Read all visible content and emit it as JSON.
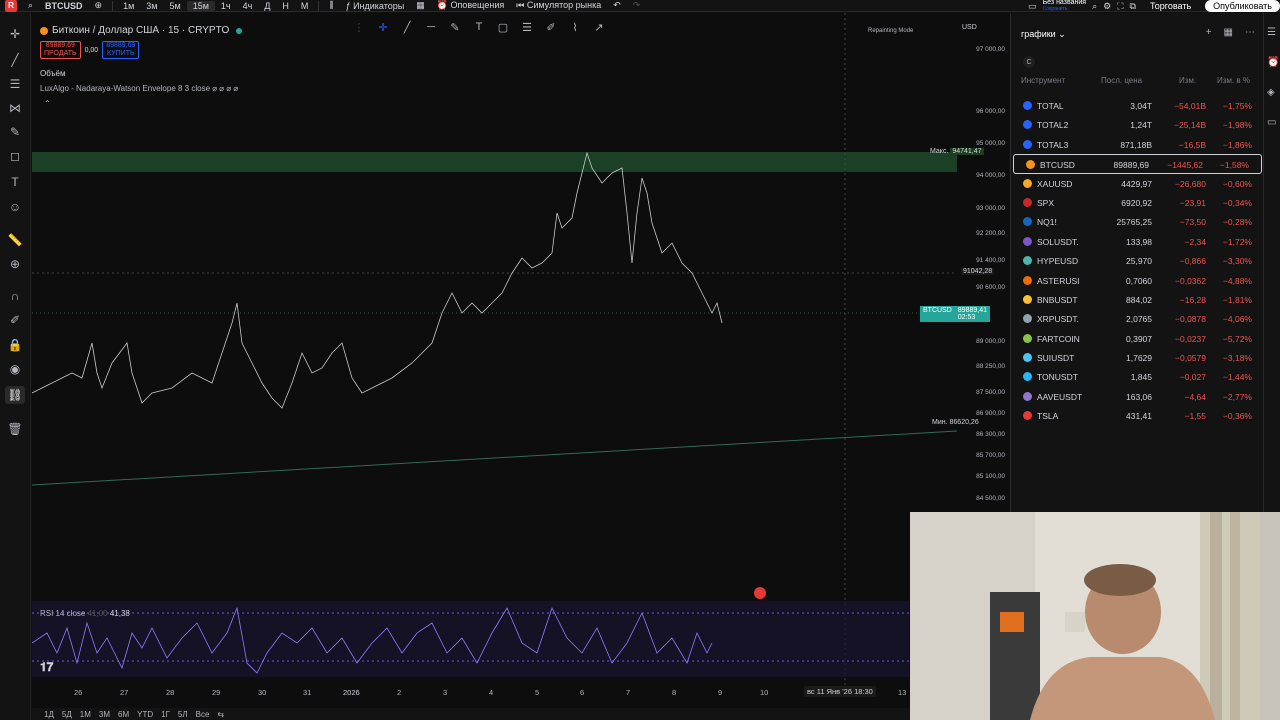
{
  "topbar": {
    "symbol": "BTCUSD",
    "intervals": [
      "1м",
      "3м",
      "5м",
      "15м",
      "1ч",
      "4ч",
      "Д",
      "Н",
      "М"
    ],
    "active_interval": "15м",
    "indicators": "Индикаторы",
    "alerts": "Оповещения",
    "replay": "Симулятор рынка",
    "unnamed_title": "Без названия",
    "unnamed_sub": "Сохранить",
    "trade": "Торговать",
    "publish": "Опубликовать"
  },
  "chart": {
    "title": "Биткоин / Доллар США · 15 · CRYPTO",
    "sell_price": "89889,69",
    "sell_label": "ПРОДАТЬ",
    "spread": "0,00",
    "buy_price": "89889,69",
    "buy_label": "КУПИТЬ",
    "volume_label": "Объём",
    "indicator_label": "LuxAlgo - Nadaraya-Watson Envelope 8 3 close",
    "repainting": "Repainting Mode",
    "currency": "USD",
    "max_label": "Макс.",
    "max_value": "94741,47",
    "min_label": "Мин.",
    "min_value": "86620,26",
    "crosshair_price": "91042,28",
    "current_symbol": "BTCUSD",
    "current_price": "89889,41",
    "current_timer": "02:53",
    "price_ticks": [
      "97 000,00",
      "96 000,00",
      "95 000,00",
      "94 000,00",
      "93 000,00",
      "92 200,00",
      "91 400,00",
      "90 600,00",
      "89 000,00",
      "88 250,00",
      "87 500,00",
      "86 900,00",
      "86 300,00",
      "85 700,00",
      "85 100,00",
      "84 500,00"
    ],
    "rsi_label": "RSI 14 close",
    "rsi_value1": "41,00",
    "rsi_value2": "41,38",
    "time_ticks": [
      "26",
      "27",
      "28",
      "29",
      "30",
      "31",
      "2026",
      "2",
      "3",
      "4",
      "5",
      "6",
      "7",
      "8",
      "9",
      "10"
    ],
    "crosshair_time": "вс 11 Янв '26   18:30",
    "last_tick": "13"
  },
  "bottombar": [
    "1Д",
    "5Д",
    "1М",
    "3М",
    "6М",
    "YTD",
    "1Г",
    "5Л",
    "Все"
  ],
  "watchlist": {
    "title": "графики",
    "filter": "C",
    "columns": {
      "instrument": "Инструмент",
      "last": "Посл. цена",
      "chg": "Изм.",
      "chg_pct": "Изм. в %"
    },
    "rows": [
      {
        "symbol": "TOTAL",
        "price": "3,04T",
        "chg": "−54,01B",
        "pct": "−1,75%",
        "color": "#2962ff"
      },
      {
        "symbol": "TOTAL2",
        "price": "1,24T",
        "chg": "−25,14B",
        "pct": "−1,98%",
        "color": "#2962ff"
      },
      {
        "symbol": "TOTAL3",
        "price": "871,18B",
        "chg": "−16,5B",
        "pct": "−1,86%",
        "color": "#2962ff"
      },
      {
        "symbol": "BTCUSD",
        "price": "89889,69",
        "chg": "−1445,62",
        "pct": "−1,58%",
        "color": "#f7931a"
      },
      {
        "symbol": "XAUUSD",
        "price": "4429,97",
        "chg": "−26,680",
        "pct": "−0,60%",
        "color": "#f9a825"
      },
      {
        "symbol": "SPX",
        "price": "6920,92",
        "chg": "−23,91",
        "pct": "−0,34%",
        "color": "#c62828"
      },
      {
        "symbol": "NQ1!",
        "price": "25765,25",
        "chg": "−73,50",
        "pct": "−0,28%",
        "color": "#1565c0"
      },
      {
        "symbol": "SOLUSDT.",
        "price": "133,98",
        "chg": "−2,34",
        "pct": "−1,72%",
        "color": "#7e57c2"
      },
      {
        "symbol": "HYPEUSD",
        "price": "25,970",
        "chg": "−0,866",
        "pct": "−3,30%",
        "color": "#4db6ac"
      },
      {
        "symbol": "ASTERUSI",
        "price": "0,7060",
        "chg": "−0,0362",
        "pct": "−4,88%",
        "color": "#ef6c00"
      },
      {
        "symbol": "BNBUSDT",
        "price": "884,02",
        "chg": "−16,28",
        "pct": "−1,81%",
        "color": "#fbc02d"
      },
      {
        "symbol": "XRPUSDT.",
        "price": "2,0765",
        "chg": "−0,0878",
        "pct": "−4,06%",
        "color": "#90a4ae"
      },
      {
        "symbol": "FARTCOIN",
        "price": "0,3907",
        "chg": "−0,0237",
        "pct": "−5,72%",
        "color": "#8bc34a"
      },
      {
        "symbol": "SUIUSDT",
        "price": "1,7629",
        "chg": "−0,0579",
        "pct": "−3,18%",
        "color": "#4fc3f7"
      },
      {
        "symbol": "TONUSDT",
        "price": "1,845",
        "chg": "−0,027",
        "pct": "−1,44%",
        "color": "#29b6f6"
      },
      {
        "symbol": "AAVEUSDT",
        "price": "163,06",
        "chg": "−4,64",
        "pct": "−2,77%",
        "color": "#9575cd"
      },
      {
        "symbol": "TSLA",
        "price": "431,41",
        "chg": "−1,55",
        "pct": "−0,36%",
        "color": "#e53935"
      }
    ]
  }
}
